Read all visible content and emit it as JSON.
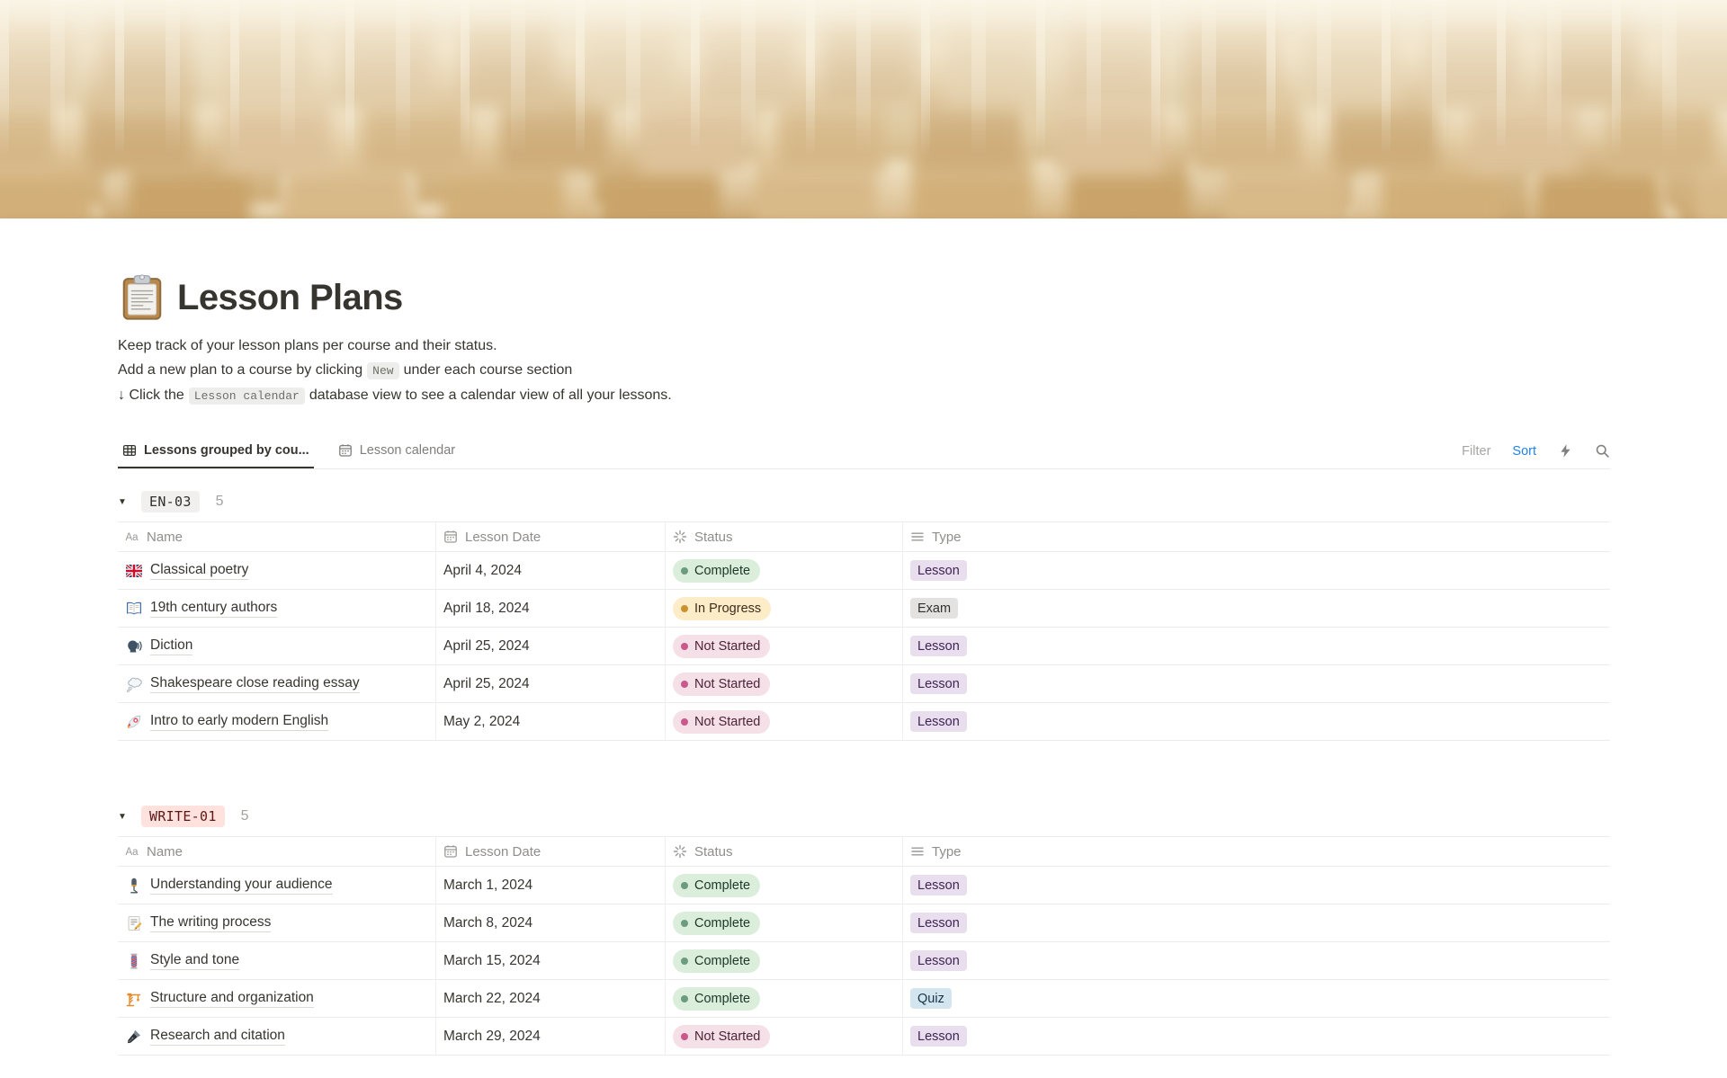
{
  "page": {
    "title": "Lesson Plans",
    "icon": "clipboard-icon"
  },
  "description": {
    "line1": "Keep track of your lesson plans per course and their status.",
    "line2_pre": "Add a new plan to a course by clicking",
    "line2_code": "New",
    "line2_post": "under each course section",
    "line3_pre": "↓ Click the",
    "line3_code": "Lesson calendar",
    "line3_post": "database view to see a calendar view of all your lessons."
  },
  "toolbar": {
    "tabs": [
      {
        "label": "Lessons grouped by cou...",
        "icon": "table-icon",
        "active": true
      },
      {
        "label": "Lesson calendar",
        "icon": "calendar-icon",
        "active": false
      }
    ],
    "filter_label": "Filter",
    "sort_label": "Sort",
    "sort_color": "#2383E2",
    "icons": [
      "lightning-icon",
      "search-icon"
    ]
  },
  "table": {
    "columns": [
      {
        "label": "Name",
        "icon": "text-icon"
      },
      {
        "label": "Lesson Date",
        "icon": "calendar-icon"
      },
      {
        "label": "Status",
        "icon": "status-icon"
      },
      {
        "label": "Type",
        "icon": "list-icon"
      }
    ]
  },
  "ui": {
    "toggle_glyph": "▼"
  },
  "groups": [
    {
      "tag": "EN-03",
      "tag_bg": "#F1F0EF",
      "tag_color": "#32302C",
      "count": "5",
      "rows": [
        {
          "icon": "uk-flag-icon",
          "name": "Classical poetry",
          "date": "April 4, 2024",
          "status": "Complete",
          "type": "Lesson"
        },
        {
          "icon": "open-book-icon",
          "name": "19th century authors",
          "date": "April 18, 2024",
          "status": "In Progress",
          "type": "Exam"
        },
        {
          "icon": "speaking-head-icon",
          "name": "Diction",
          "date": "April 25, 2024",
          "status": "Not Started",
          "type": "Lesson"
        },
        {
          "icon": "thought-balloon-icon",
          "name": "Shakespeare close reading essay",
          "date": "April 25, 2024",
          "status": "Not Started",
          "type": "Lesson"
        },
        {
          "icon": "rocket-icon",
          "name": "Intro to early modern English",
          "date": "May 2, 2024",
          "status": "Not Started",
          "type": "Lesson"
        }
      ]
    },
    {
      "tag": "WRITE-01",
      "tag_bg": "#FFE2DD",
      "tag_color": "#5D1715",
      "count": "5",
      "rows": [
        {
          "icon": "microphone-icon",
          "name": "Understanding your audience",
          "date": "March 1, 2024",
          "status": "Complete",
          "type": "Lesson"
        },
        {
          "icon": "memo-icon",
          "name": "The writing process",
          "date": "March 8, 2024",
          "status": "Complete",
          "type": "Lesson"
        },
        {
          "icon": "barber-pole-icon",
          "name": "Style and tone",
          "date": "March 15, 2024",
          "status": "Complete",
          "type": "Lesson"
        },
        {
          "icon": "crane-icon",
          "name": "Structure and organization",
          "date": "March 22, 2024",
          "status": "Complete",
          "type": "Quiz"
        },
        {
          "icon": "fountain-pen-icon",
          "name": "Research and citation",
          "date": "March 29, 2024",
          "status": "Not Started",
          "type": "Lesson"
        }
      ]
    }
  ],
  "status_styles": {
    "Complete": {
      "bg": "#DBEDDB",
      "dot": "#6C9B7D",
      "text": "#1C3829"
    },
    "In Progress": {
      "bg": "#FDECC8",
      "dot": "#CB912F",
      "text": "#402C1B"
    },
    "Not Started": {
      "bg": "#F5E0E7",
      "dot": "#C9588C",
      "text": "#4C2337"
    }
  },
  "type_styles": {
    "Lesson": {
      "bg": "#E8DEEE",
      "text": "#412454"
    },
    "Exam": {
      "bg": "#E3E2E0",
      "text": "#32302C"
    },
    "Quiz": {
      "bg": "#D3E5EF",
      "text": "#183347"
    }
  }
}
